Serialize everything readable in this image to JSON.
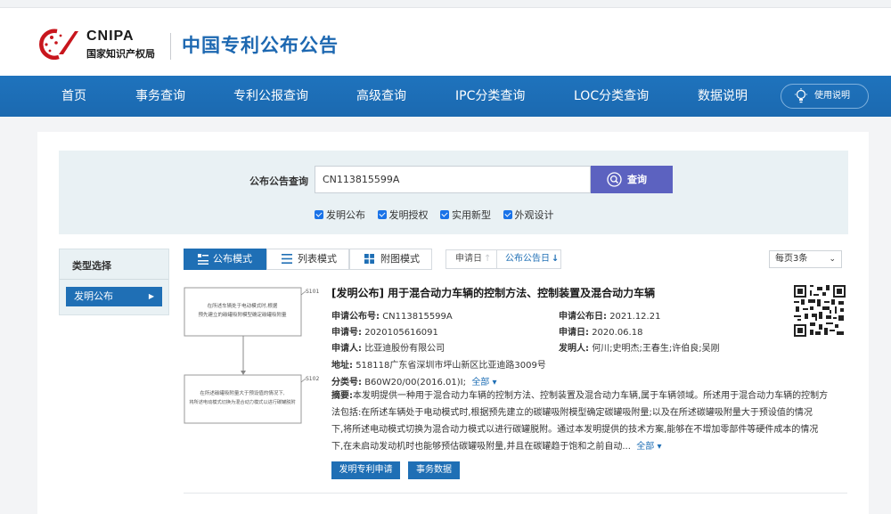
{
  "header": {
    "logo_en": "CNIPA",
    "logo_cn": "国家知识产权局",
    "site_title": "中国专利公布公告"
  },
  "nav": {
    "items": [
      "首页",
      "事务查询",
      "专利公报查询",
      "高级查询",
      "IPC分类查询",
      "LOC分类查询",
      "数据说明"
    ],
    "help": "使用说明"
  },
  "search": {
    "label": "公布公告查询",
    "value": "CN113815599A",
    "button": "查询",
    "filters": [
      "发明公布",
      "发明授权",
      "实用新型",
      "外观设计"
    ]
  },
  "sidebar": {
    "title": "类型选择",
    "item": "发明公布"
  },
  "toolbar": {
    "modes": [
      "公布模式",
      "列表模式",
      "附图模式"
    ],
    "sort_apply": "申请日",
    "sort_pub": "公布公告日",
    "per_page": "每页3条"
  },
  "result": {
    "title": "[发明公布] 用于混合动力车辆的控制方法、控制装置及混合动力车辆",
    "pub_no_label": "申请公布号:",
    "pub_no": "CN113815599A",
    "pub_date_label": "申请公布日:",
    "pub_date": "2021.12.21",
    "app_no_label": "申请号:",
    "app_no": "2020105616091",
    "app_date_label": "申请日:",
    "app_date": "2020.06.18",
    "applicant_label": "申请人:",
    "applicant": "比亚迪股份有限公司",
    "inventor_label": "发明人:",
    "inventor": "何川;史明杰;王春生;许伯良;吴刚",
    "address_label": "地址:",
    "address": "518118广东省深圳市坪山新区比亚迪路3009号",
    "class_label": "分类号:",
    "class": "B60W20/00(2016.01)I;",
    "class_all": "全部",
    "abstract_label": "摘要:",
    "abstract_lines": [
      "本发明提供一种用于混合动力车辆的控制方法、控制装置及混合动力车辆,属于车辆领域。所述用于混合动力车辆的控制方",
      "法包括:在所述车辆处于电动模式时,根据预先建立的碳罐吸附模型确定碳罐吸附量;以及在所述碳罐吸附量大于预设值的情况",
      "下,将所述电动模式切换为混合动力模式以进行碳罐脱附。通过本发明提供的技术方案,能够在不增加零部件等硬件成本的情况",
      "下,在未启动发动机时也能够预估碳罐吸附量,并且在碳罐趋于饱和之前自动..."
    ],
    "abstract_all": "全部",
    "btn_apply": "发明专利申请",
    "btn_affairs": "事务数据",
    "figure": {
      "box1_line1": "在所述车辆处于电动模式时,根据",
      "box1_line2": "预先建立的碳罐吸附模型确定碳罐吸附量",
      "box2_line1": "在所述碳罐吸附量大于预设值的情况下,",
      "box2_line2": "将所述电动模式切换为混合动力模式以进行碳罐脱附",
      "label1": "S101",
      "label2": "S102"
    }
  },
  "colors": {
    "brand_blue": "#1f6fb5",
    "title_blue": "#1d68b1",
    "search_button": "#5c62c0"
  }
}
